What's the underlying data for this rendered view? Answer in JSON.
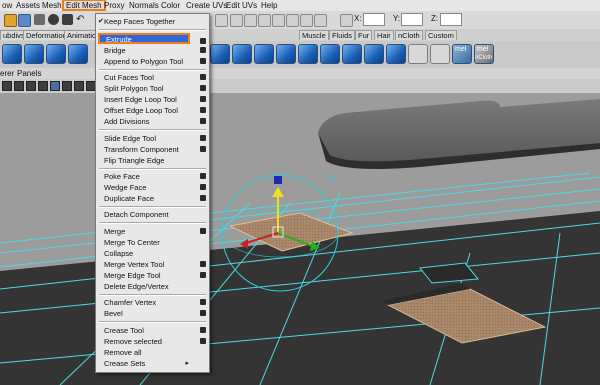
{
  "menubar": {
    "items": [
      "ow",
      "Assets",
      "Edit Mesh",
      "Proxy",
      "Normals",
      "Color",
      "Create UVs",
      "Edit UVs",
      "Help"
    ],
    "mesh_label": "Mesh"
  },
  "toolbar": {
    "coord_x_label": "X:",
    "coord_y_label": "Y:",
    "coord_z_label": "Z:"
  },
  "shelf_tabs": [
    "ubdivs",
    "Deformation",
    "Animatio",
    "Muscle",
    "Fluids",
    "Fur",
    "Hair",
    "nCloth",
    "Custom"
  ],
  "shelf_text": {
    "mel1": "mel",
    "mel2": "mel",
    "ncloth": "nCloth"
  },
  "panel_menu": [
    "erer",
    "Panels"
  ],
  "dropdown": {
    "items": [
      {
        "label": "Keep Faces Together",
        "checked": true,
        "option": false
      },
      {
        "label": "Extrude",
        "option": true,
        "highlighted": true
      },
      {
        "label": "Bridge",
        "option": true
      },
      {
        "label": "Append to Polygon Tool",
        "option": true
      },
      {
        "label": "Cut Faces Tool",
        "option": true
      },
      {
        "label": "Split Polygon Tool",
        "option": true
      },
      {
        "label": "Insert Edge Loop Tool",
        "option": true
      },
      {
        "label": "Offset Edge Loop Tool",
        "option": true
      },
      {
        "label": "Add Divisions",
        "option": true
      },
      {
        "label": "Slide Edge Tool",
        "option": true
      },
      {
        "label": "Transform Component",
        "option": true
      },
      {
        "label": "Flip Triangle Edge",
        "option": false
      },
      {
        "label": "Poke Face",
        "option": true
      },
      {
        "label": "Wedge Face",
        "option": true
      },
      {
        "label": "Duplicate Face",
        "option": true
      },
      {
        "label": "Detach Component",
        "option": false
      },
      {
        "label": "Merge",
        "option": true
      },
      {
        "label": "Merge To Center",
        "option": false
      },
      {
        "label": "Collapse",
        "option": false
      },
      {
        "label": "Merge Vertex Tool",
        "option": true
      },
      {
        "label": "Merge Edge Tool",
        "option": true
      },
      {
        "label": "Delete Edge/Vertex",
        "option": false
      },
      {
        "label": "Chamfer Vertex",
        "option": true
      },
      {
        "label": "Bevel",
        "option": true
      },
      {
        "label": "Crease Tool",
        "option": true
      },
      {
        "label": "Remove selected",
        "option": true
      },
      {
        "label": "Remove all",
        "option": false
      },
      {
        "label": "Crease Sets",
        "option": false,
        "submenu": true
      }
    ]
  },
  "colors": {
    "highlight": "#2f66d8",
    "annotation_outline": "#ef7e1a",
    "wire": "#4fd8e6",
    "face": "#a8876a"
  },
  "icons": {
    "manipulator_x": "red-cone-handle",
    "manipulator_y": "yellow-cone-handle",
    "manipulator_z": "green-cone-handle",
    "manipulator_top": "blue-cube-handle"
  }
}
